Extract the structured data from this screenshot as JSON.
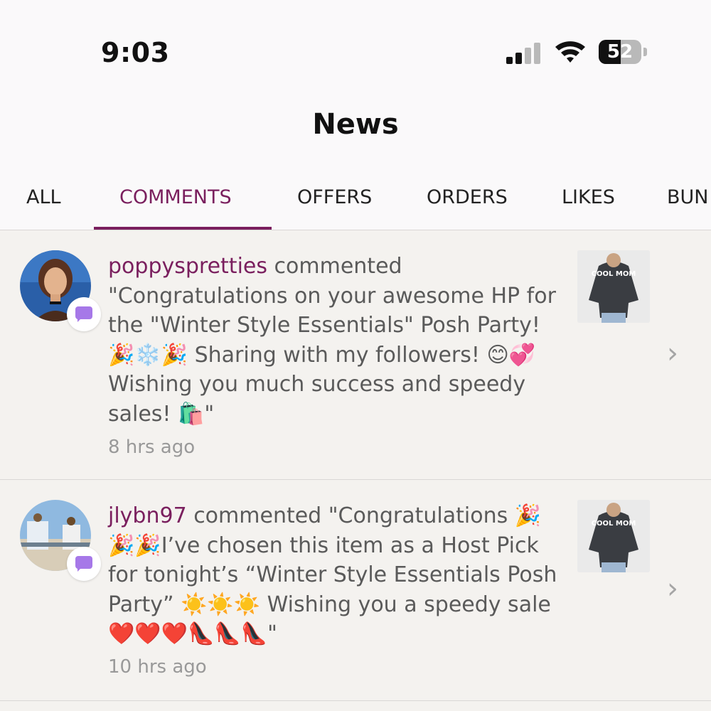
{
  "status_bar": {
    "time": "9:03",
    "battery_level": "52",
    "signal_bars": 4,
    "signal_active_bars": 2,
    "wifi": true
  },
  "header": {
    "title": "News"
  },
  "tabs": [
    {
      "label": "ALL",
      "active": false
    },
    {
      "label": "COMMENTS",
      "active": true
    },
    {
      "label": "OFFERS",
      "active": false
    },
    {
      "label": "ORDERS",
      "active": false
    },
    {
      "label": "LIKES",
      "active": false
    },
    {
      "label": "BUN",
      "active": false
    }
  ],
  "notifications": [
    {
      "username": "poppyspretties",
      "message": " commented \"Congratulations on your awesome HP for the \"Winter Style Essentials\" Posh Party! 🎉❄️🎉 Sharing with my followers! 😊💞 Wishing you much success and speedy sales! 🛍️\"",
      "time_ago": "8 hrs ago",
      "thumbnail_text": "COOL MOM"
    },
    {
      "username": "jlybn97",
      "message": " commented \"Congratulations 🎉🎉🎉I’ve chosen this item as a Host Pick for tonight’s “Winter Style Essentials Posh Party” ☀️☀️☀️ Wishing you a speedy sale ❤️❤️❤️👠👠👠\"",
      "time_ago": "10 hrs ago",
      "thumbnail_text": "COOL MOM"
    }
  ],
  "colors": {
    "accent": "#7a1f5e",
    "badge": "#a678e8",
    "background": "#f4f2ef"
  }
}
